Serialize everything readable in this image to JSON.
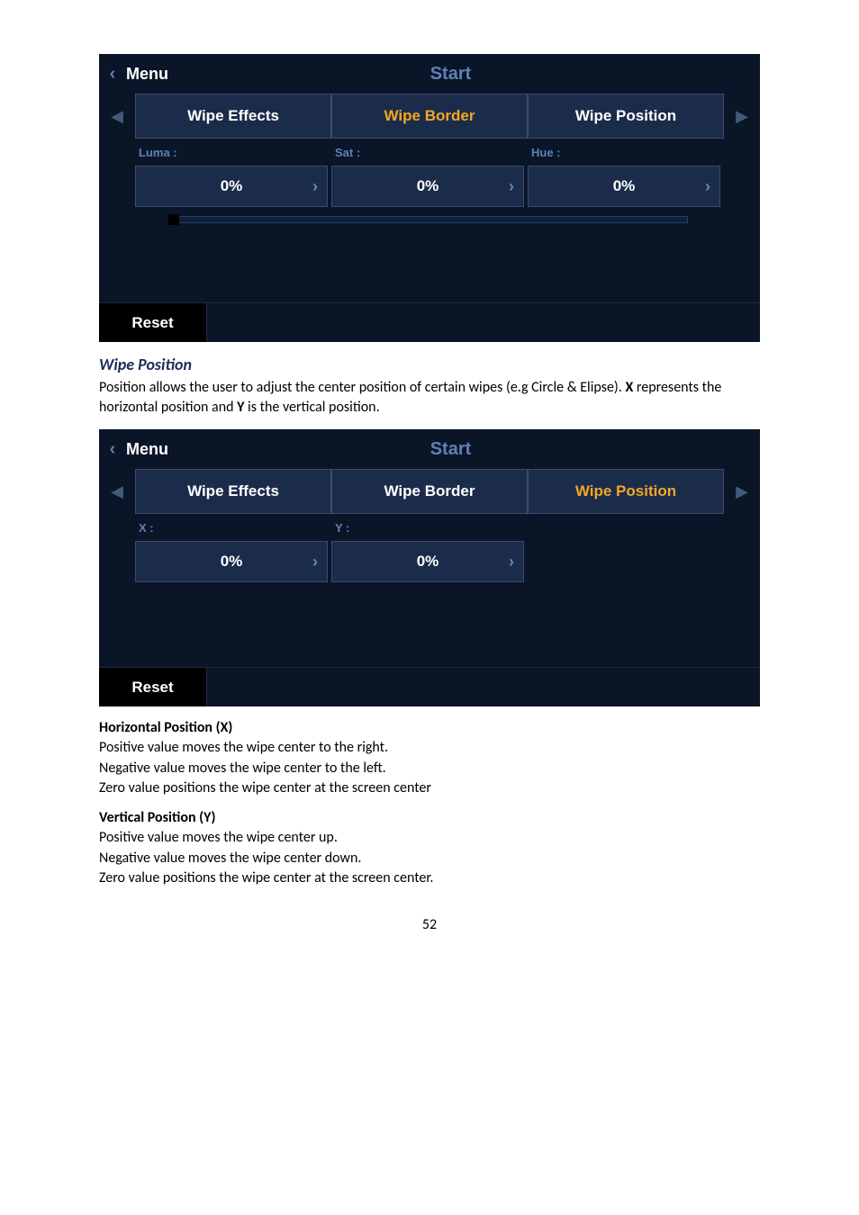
{
  "panel1": {
    "menu": "Menu",
    "title": "Start",
    "tabs": [
      "Wipe Effects",
      "Wipe Border",
      "Wipe Position"
    ],
    "activeTab": 1,
    "params": [
      {
        "label": "Luma :",
        "value": "0%"
      },
      {
        "label": "Sat :",
        "value": "0%"
      },
      {
        "label": "Hue :",
        "value": "0%"
      }
    ],
    "reset": "Reset"
  },
  "section": {
    "heading": "Wipe Position",
    "body_a": "Position allows the user to adjust the center position of certain wipes (e.g Circle & Elipse). ",
    "body_bold": "X",
    "body_b": " represents the horizontal position and ",
    "body_bold2": "Y",
    "body_c": " is the vertical position."
  },
  "panel2": {
    "menu": "Menu",
    "title": "Start",
    "tabs": [
      "Wipe Effects",
      "Wipe Border",
      "Wipe Position"
    ],
    "activeTab": 2,
    "params": [
      {
        "label": "X :",
        "value": "0%"
      },
      {
        "label": "Y :",
        "value": "0%"
      }
    ],
    "reset": "Reset"
  },
  "hpos": {
    "heading": "Horizontal Position (X)",
    "l1": "Positive value moves the wipe center to the right.",
    "l2": "Negative value moves the wipe center to the left.",
    "l3": "Zero value positions the wipe center at the screen center"
  },
  "vpos": {
    "heading": "Vertical Position (Y)",
    "l1": "Positive value moves the wipe center up.",
    "l2": "Negative value moves the wipe center down.",
    "l3": "Zero value positions the wipe center at the screen center."
  },
  "pageNumber": "52"
}
